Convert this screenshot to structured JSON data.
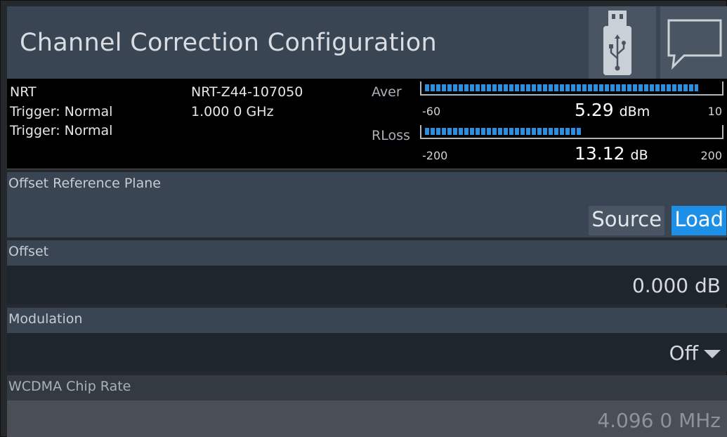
{
  "header": {
    "title": "Channel Correction Configuration",
    "usb_icon": "usb-icon",
    "message_icon": "message-icon"
  },
  "measurement": {
    "left": {
      "line1": "NRT",
      "line2": "Trigger: Normal",
      "line3": "Trigger: Normal"
    },
    "middle": {
      "line1": "NRT-Z44-107050",
      "line2": "1.000 0 GHz"
    },
    "aver": {
      "label": "Aver",
      "min": "-60",
      "max": "10",
      "value": "5.29",
      "unit": "dBm",
      "fill_fraction": 0.93
    },
    "rloss": {
      "label": "RLoss",
      "min": "-200",
      "max": "200",
      "value": "13.12",
      "unit": "dB",
      "fill_fraction": 0.53
    },
    "bar_color": "#2a8fe0"
  },
  "offset_reference_plane": {
    "label": "Offset Reference Plane",
    "options": [
      "Source",
      "Load"
    ],
    "selected": "Load",
    "selected_color": "#1e8fe6"
  },
  "offset": {
    "label": "Offset",
    "value": "0.000  dB"
  },
  "modulation": {
    "label": "Modulation",
    "value": "Off"
  },
  "wcdma_chip_rate": {
    "label": "WCDMA Chip Rate",
    "value": "4.096 0  MHz"
  }
}
